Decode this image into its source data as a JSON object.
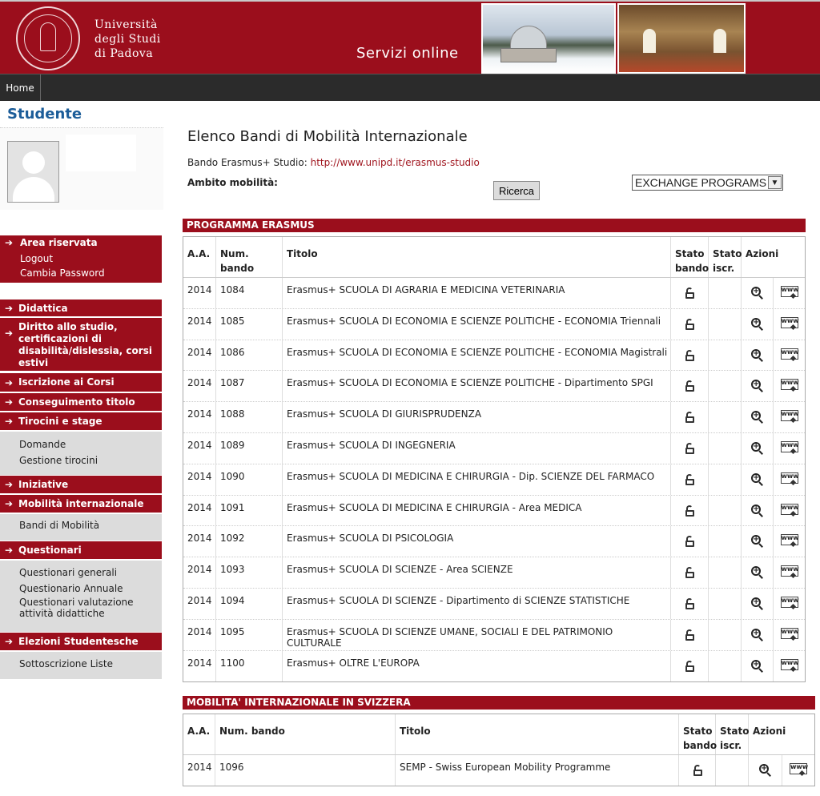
{
  "header": {
    "university_line1": "Università",
    "university_line2": "degli Studi",
    "university_line3": "di Padova",
    "service_title": "Servizi online"
  },
  "nav": {
    "home_label": "Home"
  },
  "sidebar": {
    "title": "Studente",
    "area_riservata": "Area riservata",
    "area_links": [
      "Logout",
      "Cambia Password"
    ],
    "sections": [
      {
        "label": "Didattica",
        "items": []
      },
      {
        "label": "Diritto allo studio, certificazioni di disabilità/dislessia, corsi estivi",
        "items": []
      },
      {
        "label": "Iscrizione ai Corsi",
        "items": []
      },
      {
        "label": "Conseguimento titolo",
        "items": []
      },
      {
        "label": "Tirocini e stage",
        "items": [
          "Domande",
          "Gestione tirocini"
        ]
      },
      {
        "label": "Iniziative",
        "items": []
      },
      {
        "label": "Mobilità internazionale",
        "items": [
          "Bandi di Mobilità"
        ]
      },
      {
        "label": "Questionari",
        "items": [
          "Questionari generali",
          "Questionario Annuale",
          "Questionari valutazione attività didattiche"
        ]
      },
      {
        "label": "Elezioni Studentesche",
        "items": [
          "Sottoscrizione Liste"
        ]
      }
    ]
  },
  "main": {
    "title": "Elenco Bandi di Mobilità Internazionale",
    "bando_prefix": "Bando Erasmus+ Studio:",
    "bando_link": "http://www.unipd.it/erasmus-studio",
    "ambito_label": "Ambito mobilità:",
    "ricerca_label": "Ricerca",
    "ambito_value": "EXCHANGE PROGRAMS"
  },
  "columns": {
    "aa": "A.A.",
    "num": "Num. bando",
    "titolo": "Titolo",
    "stato_bando_1": "Stato",
    "stato_bando_2": "bando",
    "stato_iscr_1": "Stato",
    "stato_iscr_2": "iscr.",
    "azioni": "Azioni"
  },
  "icons": {
    "lock": "lock-open-icon",
    "zoom": "zoom-in-icon",
    "www": "www-link-icon"
  },
  "erasmus": {
    "section_title": "PROGRAMMA ERASMUS",
    "rows": [
      {
        "aa": "2014",
        "num": "1084",
        "titolo": "Erasmus+ SCUOLA DI AGRARIA E MEDICINA VETERINARIA"
      },
      {
        "aa": "2014",
        "num": "1085",
        "titolo": "Erasmus+ SCUOLA DI ECONOMIA E SCIENZE POLITICHE - ECONOMIA Triennali"
      },
      {
        "aa": "2014",
        "num": "1086",
        "titolo": "Erasmus+ SCUOLA DI ECONOMIA E SCIENZE POLITICHE - ECONOMIA Magistrali"
      },
      {
        "aa": "2014",
        "num": "1087",
        "titolo": "Erasmus+ SCUOLA DI ECONOMIA E SCIENZE POLITICHE - Dipartimento SPGI"
      },
      {
        "aa": "2014",
        "num": "1088",
        "titolo": "Erasmus+ SCUOLA DI GIURISPRUDENZA"
      },
      {
        "aa": "2014",
        "num": "1089",
        "titolo": "Erasmus+ SCUOLA DI INGEGNERIA"
      },
      {
        "aa": "2014",
        "num": "1090",
        "titolo": "Erasmus+ SCUOLA DI MEDICINA E CHIRURGIA - Dip. SCIENZE DEL FARMACO"
      },
      {
        "aa": "2014",
        "num": "1091",
        "titolo": "Erasmus+ SCUOLA DI MEDICINA E CHIRURGIA - Area MEDICA"
      },
      {
        "aa": "2014",
        "num": "1092",
        "titolo": "Erasmus+ SCUOLA DI PSICOLOGIA"
      },
      {
        "aa": "2014",
        "num": "1093",
        "titolo": "Erasmus+ SCUOLA DI SCIENZE - Area SCIENZE"
      },
      {
        "aa": "2014",
        "num": "1094",
        "titolo": "Erasmus+ SCUOLA DI SCIENZE - Dipartimento di SCIENZE STATISTICHE"
      },
      {
        "aa": "2014",
        "num": "1095",
        "titolo": "Erasmus+ SCUOLA DI SCIENZE UMANE, SOCIALI E DEL PATRIMONIO CULTURALE"
      },
      {
        "aa": "2014",
        "num": "1100",
        "titolo": "Erasmus+ OLTRE L'EUROPA"
      }
    ]
  },
  "swiss": {
    "section_title": "MOBILITA' INTERNAZIONALE IN SVIZZERA",
    "rows": [
      {
        "aa": "2014",
        "num": "1096",
        "titolo": "SEMP - Swiss European Mobility Programme"
      }
    ]
  }
}
